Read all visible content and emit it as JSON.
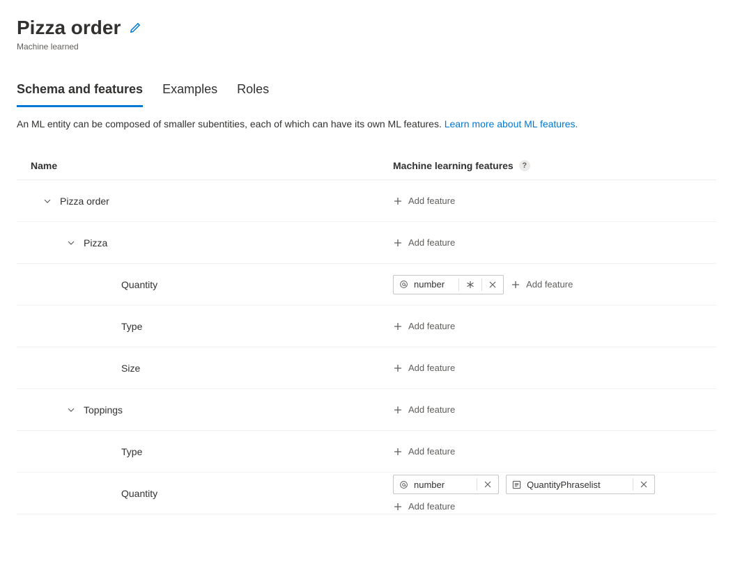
{
  "header": {
    "title": "Pizza order",
    "subtitle": "Machine learned"
  },
  "tabs": [
    {
      "label": "Schema and features",
      "active": true
    },
    {
      "label": "Examples",
      "active": false
    },
    {
      "label": "Roles",
      "active": false
    }
  ],
  "description": {
    "text": "An ML entity can be composed of smaller subentities, each of which can have its own ML features.",
    "link": "Learn more about ML features."
  },
  "columns": {
    "name": "Name",
    "features": "Machine learning features"
  },
  "add_feature_label": "Add feature",
  "rows": [
    {
      "name": "Pizza order",
      "indent": 0,
      "expandable": true,
      "features": []
    },
    {
      "name": "Pizza",
      "indent": 1,
      "expandable": true,
      "features": []
    },
    {
      "name": "Quantity",
      "indent": 2,
      "expandable": false,
      "features": [
        {
          "type": "entity",
          "label": "number",
          "hasAsterisk": true,
          "removable": true
        }
      ]
    },
    {
      "name": "Type",
      "indent": 2,
      "expandable": false,
      "features": []
    },
    {
      "name": "Size",
      "indent": 2,
      "expandable": false,
      "features": []
    },
    {
      "name": "Toppings",
      "indent": 1,
      "expandable": true,
      "features": []
    },
    {
      "name": "Type",
      "indent": 2,
      "expandable": false,
      "features": []
    },
    {
      "name": "Quantity",
      "indent": 2,
      "expandable": false,
      "features": [
        {
          "type": "entity",
          "label": "number",
          "hasAsterisk": false,
          "removable": true
        },
        {
          "type": "phraselist",
          "label": "QuantityPhraselist",
          "hasAsterisk": false,
          "removable": true
        }
      ]
    }
  ]
}
